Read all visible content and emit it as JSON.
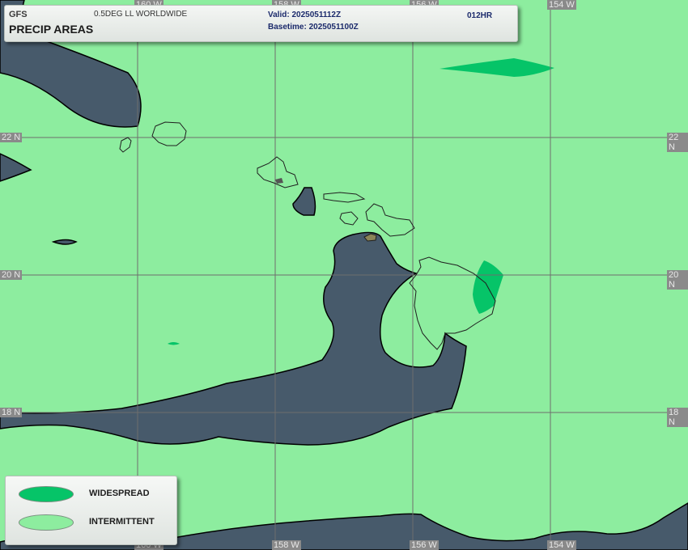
{
  "header": {
    "model": "GFS",
    "product": "PRECIP AREAS",
    "grid": "0.5DEG LL WORLDWIDE",
    "valid": "Valid: 2025051112Z",
    "basetime": "Basetime: 2025051100Z",
    "forecast_hour": "012HR"
  },
  "latitudes": [
    {
      "label": "22 N",
      "value": 22
    },
    {
      "label": "20 N",
      "value": 20
    },
    {
      "label": "18 N",
      "value": 18
    }
  ],
  "longitudes": [
    {
      "label": "160 W",
      "value": -160
    },
    {
      "label": "158 W",
      "value": -158
    },
    {
      "label": "156 W",
      "value": -156
    },
    {
      "label": "154 W",
      "value": -154
    }
  ],
  "legend": {
    "items": [
      {
        "label": "WIDESPREAD",
        "color": "#06c468"
      },
      {
        "label": "INTERMITTENT",
        "color": "#8ded9f"
      }
    ]
  },
  "colors": {
    "intermittent": "#8ded9f",
    "widespread": "#06c468",
    "no_precip": "#475a6b",
    "coastline": "#1f1f1f",
    "grid": "#6e6e6e"
  }
}
